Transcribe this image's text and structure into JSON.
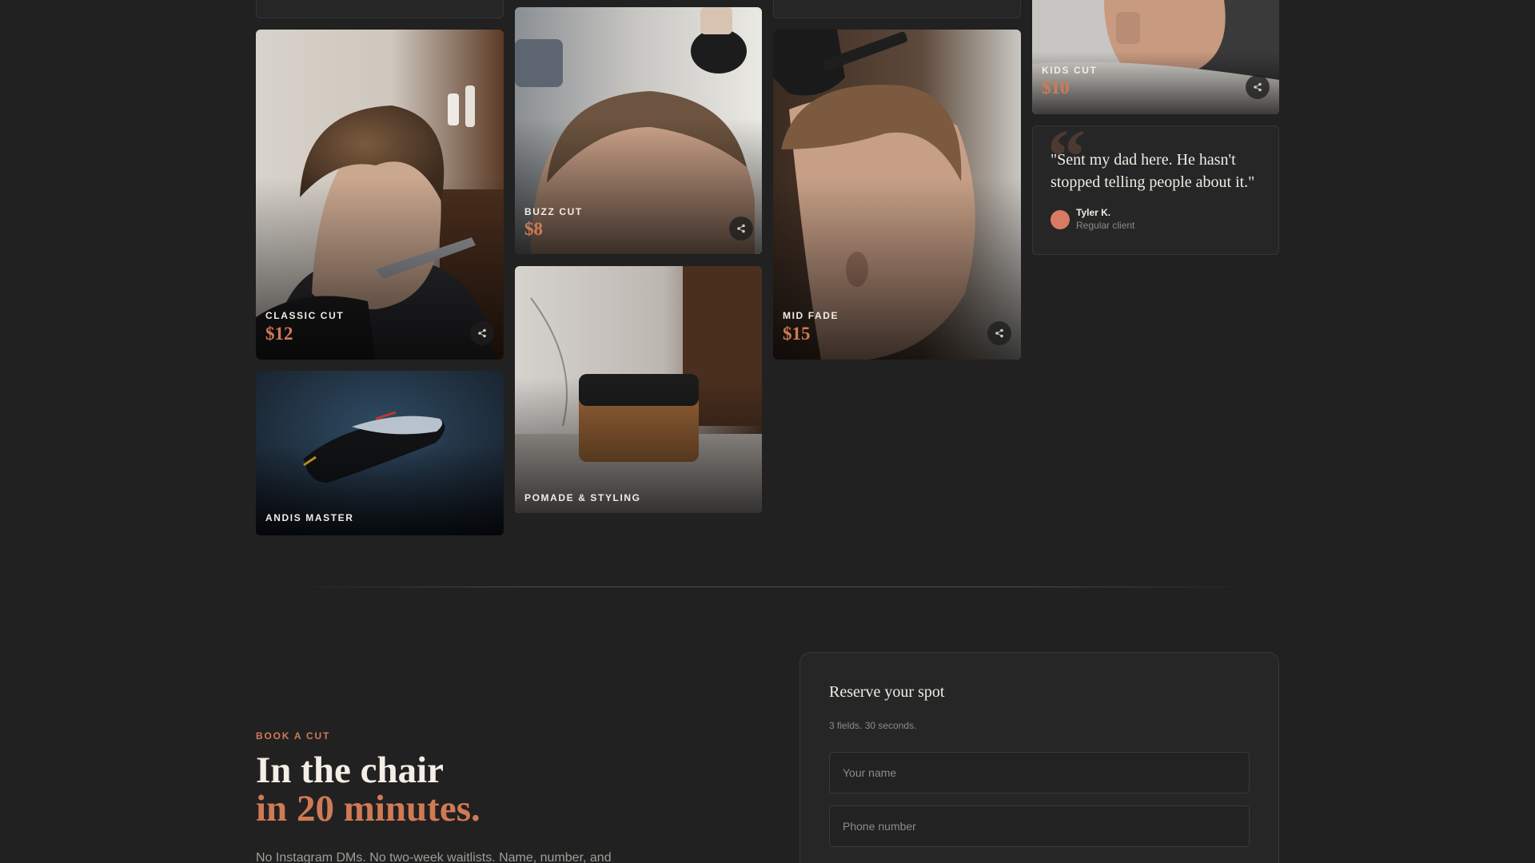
{
  "gallery": {
    "classic_cut": {
      "label": "CLASSIC CUT",
      "price": "$12"
    },
    "buzz_cut": {
      "label": "BUZZ CUT",
      "price": "$8"
    },
    "mid_fade": {
      "label": "MID FADE",
      "price": "$15"
    },
    "kids_cut": {
      "label": "KIDS CUT",
      "price": "$10"
    },
    "andis_master": {
      "label": "ANDIS MASTER"
    },
    "pomade": {
      "label": "POMADE & STYLING"
    }
  },
  "testimonial": {
    "quote": "\"Sent my dad here. He hasn't stopped telling people about it.\"",
    "author": "Tyler K.",
    "role": "Regular client"
  },
  "booking": {
    "eyebrow": "BOOK A CUT",
    "headline_line1": "In the chair",
    "headline_line2": "in 20 minutes.",
    "lede": "No Instagram DMs. No two-week waitlists. Name, number, and",
    "form": {
      "title": "Reserve your spot",
      "subtitle": "3 fields. 30 seconds.",
      "name_placeholder": "Your name",
      "phone_placeholder": "Phone number"
    }
  },
  "icons": {
    "share": "share-icon",
    "quote": "quote-mark-icon"
  },
  "colors": {
    "background": "#212121",
    "accent": "#d07a55",
    "card": "#262626"
  }
}
